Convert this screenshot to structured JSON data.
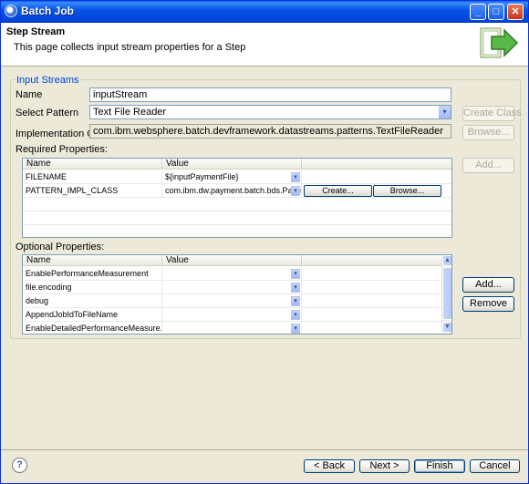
{
  "window": {
    "title": "Batch Job",
    "minimize_label": "_",
    "maximize_label": "□",
    "close_label": "✕"
  },
  "header": {
    "title": "Step Stream",
    "description": "This page collects input stream properties for a Step"
  },
  "group": {
    "legend": "Input Streams"
  },
  "form": {
    "name_label": "Name",
    "name_value": "inputStream",
    "pattern_label": "Select Pattern",
    "pattern_value": "Text File Reader",
    "impl_label": "Implementation Class",
    "impl_value": "com.ibm.websphere.batch.devframework.datastreams.patterns.TextFileReader",
    "create_class_label": "Create Class",
    "browse_label": "Browse..."
  },
  "required": {
    "label": "Required Properties:",
    "col_name": "Name",
    "col_value": "Value",
    "rows": [
      {
        "name": "FILENAME",
        "value": "${inputPaymentFile}"
      },
      {
        "name": "PATTERN_IMPL_CLASS",
        "value": "com.ibm.dw.payment.batch.bds.Paym",
        "create": "Create...",
        "browse": "Browse..."
      }
    ],
    "add_label": "Add..."
  },
  "optional": {
    "label": "Optional Properties:",
    "col_name": "Name",
    "col_value": "Value",
    "rows": [
      {
        "name": "EnablePerformanceMeasurement"
      },
      {
        "name": "file.encoding"
      },
      {
        "name": "debug"
      },
      {
        "name": "AppendJobIdToFileName"
      },
      {
        "name": "EnableDetailedPerformanceMeasure..."
      }
    ],
    "add_label": "Add...",
    "remove_label": "Remove"
  },
  "footer": {
    "help": "?",
    "back": "< Back",
    "next": "Next >",
    "finish": "Finish",
    "cancel": "Cancel"
  },
  "icons": {
    "arrow": "▾",
    "scroll_up": "▲",
    "scroll_down": "▼"
  }
}
